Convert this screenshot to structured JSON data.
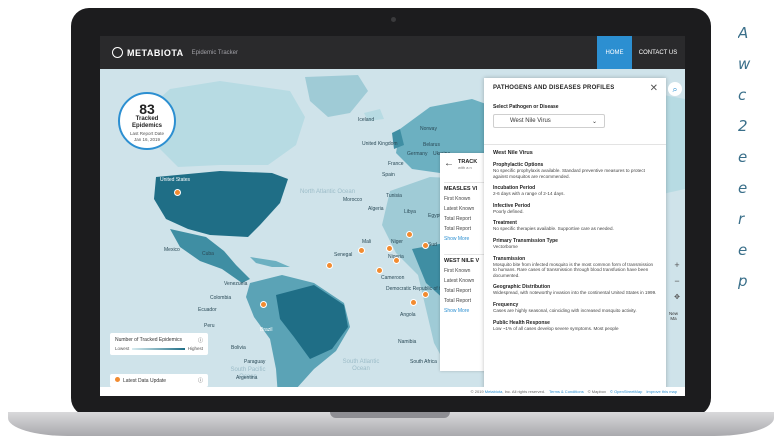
{
  "nav": {
    "brand": "METABIOTA",
    "brand_sub": "Epidemic Tracker",
    "home_label": "HOME",
    "contact_label": "CONTACT US",
    "accent_color": "#2c8fd1"
  },
  "counter": {
    "number": "83",
    "label_line1": "Tracked",
    "label_line2": "Epidemics",
    "date_line1": "Last Report Date",
    "date_line2": "Jan 16, 2019"
  },
  "map": {
    "ocean_north_atlantic": "North Atlantic Ocean",
    "ocean_south_pacific": "South Pacific Ocean",
    "ocean_south_atlantic": "South Atlantic Ocean",
    "countries": {
      "iceland": "Iceland",
      "norway": "Norway",
      "uk": "United Kingdom",
      "belarus": "Belarus",
      "germany": "Germany",
      "ukraine": "Ukraine",
      "france": "France",
      "spain": "Spain",
      "tunisia": "Tunisia",
      "morocco": "Morocco",
      "algeria": "Algeria",
      "libya": "Libya",
      "egypt": "Egypt",
      "mali": "Mali",
      "niger": "Niger",
      "sudan": "Sud",
      "senegal": "Senegal",
      "nigeria": "Nigeria",
      "cameroon": "Cameroon",
      "drc": "Democratic Republic of the Congo",
      "angola": "Angola",
      "namibia": "Namibia",
      "south_africa": "South Africa",
      "usa": "United States",
      "mexico": "Mexico",
      "cuba": "Cuba",
      "venezuela": "Venezuela",
      "colombia": "Colombia",
      "ecuador": "Ecuador",
      "peru": "Peru",
      "brazil": "Brazil",
      "bolivia": "Bolivia",
      "paraguay": "Paraguay",
      "argentina": "Argentina"
    }
  },
  "legend": {
    "title": "Number of Tracked Epidemics",
    "lowest": "Lowest",
    "highest": "Highest",
    "latest_update": "Latest Data Update"
  },
  "tracked": {
    "title": "TRACK",
    "subtitle": "with a n",
    "sections": [
      {
        "name": "MEASLES VI",
        "rows": [
          "First Known",
          "Latest Known",
          "Total Report",
          "Total Report"
        ],
        "more": "Show More"
      },
      {
        "name": "WEST NILE V",
        "rows": [
          "First Known",
          "Latest Known",
          "Total Report",
          "Total Report"
        ],
        "more": "Show More"
      }
    ]
  },
  "profile": {
    "title": "PATHOGENS AND DISEASES PROFILES",
    "select_label": "Select Pathogen or Disease",
    "select_value": "West Nile Virus",
    "disease_name": "West Nile Virus",
    "sections": [
      {
        "title": "Prophylactic Options",
        "text": "No specific prophylaxis available. Standard preventive measures to protect against mosquitos are recommended."
      },
      {
        "title": "Incubation Period",
        "text": "2-6 days with a range of 2-14 days."
      },
      {
        "title": "Infective Period",
        "text": "Poorly defined."
      },
      {
        "title": "Treatment",
        "text": "No specific therapies available. Supportive care as needed."
      },
      {
        "title": "Primary Transmission Type",
        "text": "Vectorborne"
      },
      {
        "title": "Transmission",
        "text": "Mosquito bite from infected mosquito is the most common form of transmission to humans. Rare cases of transmission through blood transfusion have been documented."
      },
      {
        "title": "Geographic Distribution",
        "text": "Widespread, with noteworthy invasion into the continental United States in 1999."
      },
      {
        "title": "Frequency",
        "text": "Cases are highly seasonal, coinciding with increased mosquito activity."
      },
      {
        "title": "Public Health Response",
        "text": "Low ~1% of all cases develop severe symptoms. Most people"
      }
    ]
  },
  "controls": {
    "new_line1": "New",
    "new_line2": "Ma"
  },
  "footer": {
    "copyright_prefix": "© 2019",
    "company": "Metabiota",
    "copyright_suffix": ", Inc. All rights reserved.",
    "terms": "Terms & Conditions",
    "mapbox": "© Mapbox",
    "osm": "© OpenStreetMap",
    "improve": "Improve this map"
  },
  "side_text": [
    "A",
    "w",
    "c",
    "2",
    "e",
    "e",
    "r",
    "e",
    "p"
  ]
}
